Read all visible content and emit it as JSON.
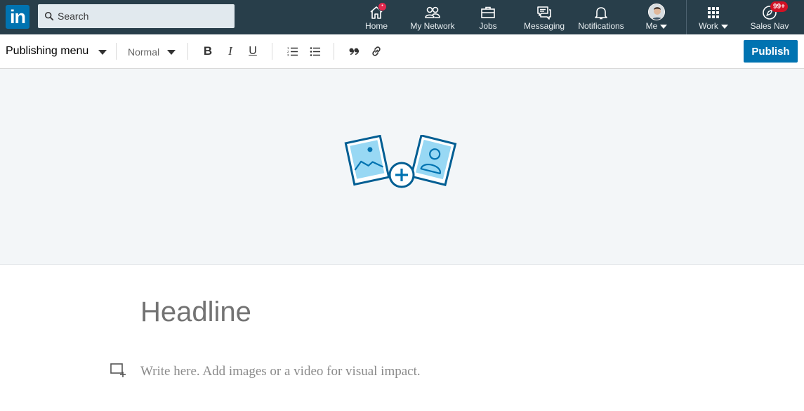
{
  "brand": {
    "logo_text": "in",
    "brand_color": "#0073b1",
    "nav_bg": "#283e4a"
  },
  "search": {
    "placeholder": "Search",
    "icon": "search-icon"
  },
  "nav": {
    "home": {
      "label": "Home",
      "icon": "home-icon",
      "badge": "•"
    },
    "network": {
      "label": "My Network",
      "icon": "people-icon"
    },
    "jobs": {
      "label": "Jobs",
      "icon": "briefcase-icon"
    },
    "messaging": {
      "label": "Messaging",
      "icon": "chat-icon"
    },
    "notifications": {
      "label": "Notifications",
      "icon": "bell-icon"
    },
    "me": {
      "label": "Me",
      "icon": "avatar"
    },
    "work": {
      "label": "Work",
      "icon": "grid-icon"
    },
    "salesnav": {
      "label": "Sales Nav",
      "icon": "compass-icon",
      "badge": "99+"
    }
  },
  "toolbar": {
    "publishing_menu": "Publishing menu",
    "style_select": "Normal",
    "bold": "B",
    "italic": "I",
    "underline": "U",
    "publish": "Publish",
    "accent": "#0073b1"
  },
  "editor": {
    "cover_icon": "add-photo-icon",
    "headline_placeholder": "Headline",
    "body_placeholder": "Write here. Add images or a video for visual impact.",
    "media_icon": "add-media-icon"
  }
}
